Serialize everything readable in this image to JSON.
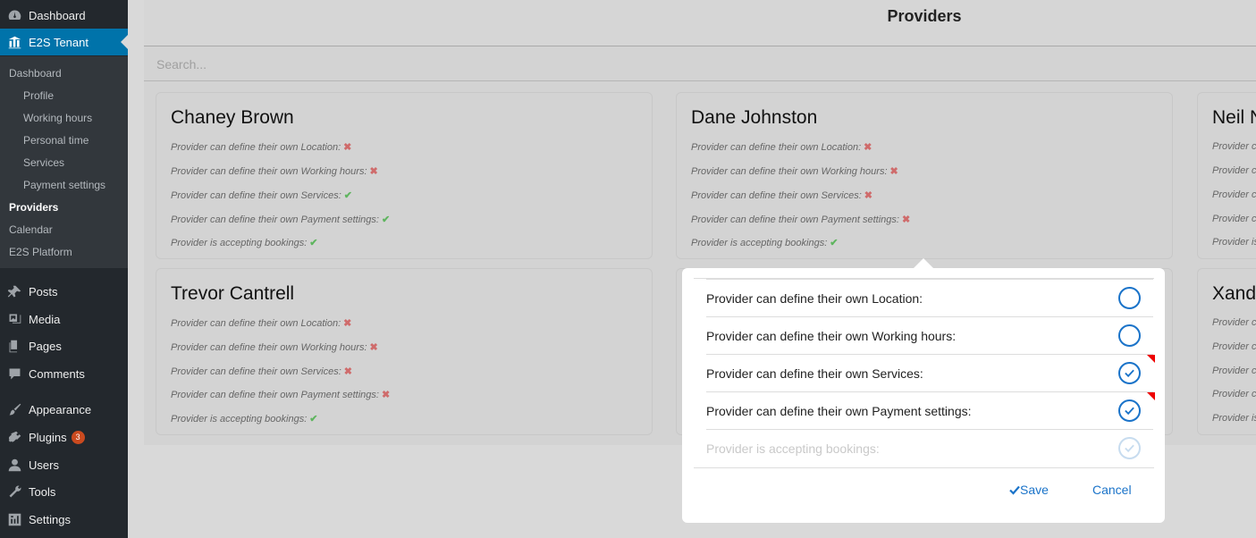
{
  "sidebar": {
    "top": [
      {
        "label": "Dashboard",
        "icon": "dashboard-icon"
      },
      {
        "label": "E2S Tenant",
        "icon": "tenant-icon"
      }
    ],
    "submenu": [
      {
        "label": "Dashboard"
      },
      {
        "label": "Profile"
      },
      {
        "label": "Working hours"
      },
      {
        "label": "Personal time"
      },
      {
        "label": "Services"
      },
      {
        "label": "Payment settings"
      },
      {
        "label": "Providers"
      },
      {
        "label": "Calendar"
      },
      {
        "label": "E2S Platform"
      }
    ],
    "bottom": [
      {
        "label": "Posts",
        "icon": "pushpin-icon"
      },
      {
        "label": "Media",
        "icon": "media-icon"
      },
      {
        "label": "Pages",
        "icon": "pages-icon"
      },
      {
        "label": "Comments",
        "icon": "comments-icon"
      },
      {
        "label": "Appearance",
        "icon": "paintbrush-icon"
      },
      {
        "label": "Plugins",
        "icon": "plug-icon",
        "badge": "3"
      },
      {
        "label": "Users",
        "icon": "user-icon"
      },
      {
        "label": "Tools",
        "icon": "wrench-icon"
      },
      {
        "label": "Settings",
        "icon": "settings-icon"
      }
    ]
  },
  "main": {
    "title": "Providers",
    "search_placeholder": "Search..."
  },
  "cards": [
    {
      "name": "Chaney Brown",
      "perms": [
        {
          "label": "Provider can define their own Location:",
          "value": "✖"
        },
        {
          "label": "Provider can define their own Working hours:",
          "value": "✖"
        },
        {
          "label": "Provider can define their own Services:",
          "value": "✔"
        },
        {
          "label": "Provider can define their own Payment settings:",
          "value": "✔"
        },
        {
          "label": "Provider is accepting bookings:",
          "value": "✔"
        }
      ]
    },
    {
      "name": "Dane Johnston",
      "perms": [
        {
          "label": "Provider can define their own Location:",
          "value": "✖"
        },
        {
          "label": "Provider can define their own Working hours:",
          "value": "✖"
        },
        {
          "label": "Provider can define their own Services:",
          "value": "✖"
        },
        {
          "label": "Provider can define their own Payment settings:",
          "value": "✖"
        },
        {
          "label": "Provider is accepting bookings:",
          "value": "✔"
        }
      ]
    },
    {
      "name": "Neil N",
      "perms": [
        {
          "label": "Provider ca"
        },
        {
          "label": "Provider ca"
        },
        {
          "label": "Provider ca"
        },
        {
          "label": "Provider ca"
        },
        {
          "label": "Provider is"
        }
      ]
    },
    {
      "name": "Trevor Cantrell",
      "perms": [
        {
          "label": "Provider can define their own Location:",
          "value": "✖"
        },
        {
          "label": "Provider can define their own Working hours:",
          "value": "✖"
        },
        {
          "label": "Provider can define their own Services:",
          "value": "✖"
        },
        {
          "label": "Provider can define their own Payment settings:",
          "value": "✖"
        },
        {
          "label": "Provider is accepting bookings:",
          "value": "✔"
        }
      ]
    },
    {
      "name": "Xand",
      "perms": [
        {
          "label": "Provider ca"
        },
        {
          "label": "Provider ca"
        },
        {
          "label": "Provider ca"
        },
        {
          "label": "Provider ca"
        },
        {
          "label": "Provider is"
        }
      ]
    }
  ],
  "popup": {
    "rows": [
      {
        "label": "Provider can define their own Location:",
        "checked": false,
        "changed": false,
        "disabled": false
      },
      {
        "label": "Provider can define their own Working hours:",
        "checked": false,
        "changed": false,
        "disabled": false
      },
      {
        "label": "Provider can define their own Services:",
        "checked": true,
        "changed": true,
        "disabled": false
      },
      {
        "label": "Provider can define their own Payment settings:",
        "checked": true,
        "changed": true,
        "disabled": false
      },
      {
        "label": "Provider is accepting bookings:",
        "checked": true,
        "changed": false,
        "disabled": true
      }
    ],
    "save_label": "Save",
    "cancel_label": "Cancel"
  },
  "colors": {
    "sidebar_bg": "#23282d",
    "submenu_bg": "#32373c",
    "active_menu": "#0073aa",
    "accent": "#1a73c9",
    "no_mark": "#cf6b6b",
    "yes_mark": "#5fb55f",
    "changed_flag": "#e00000"
  }
}
